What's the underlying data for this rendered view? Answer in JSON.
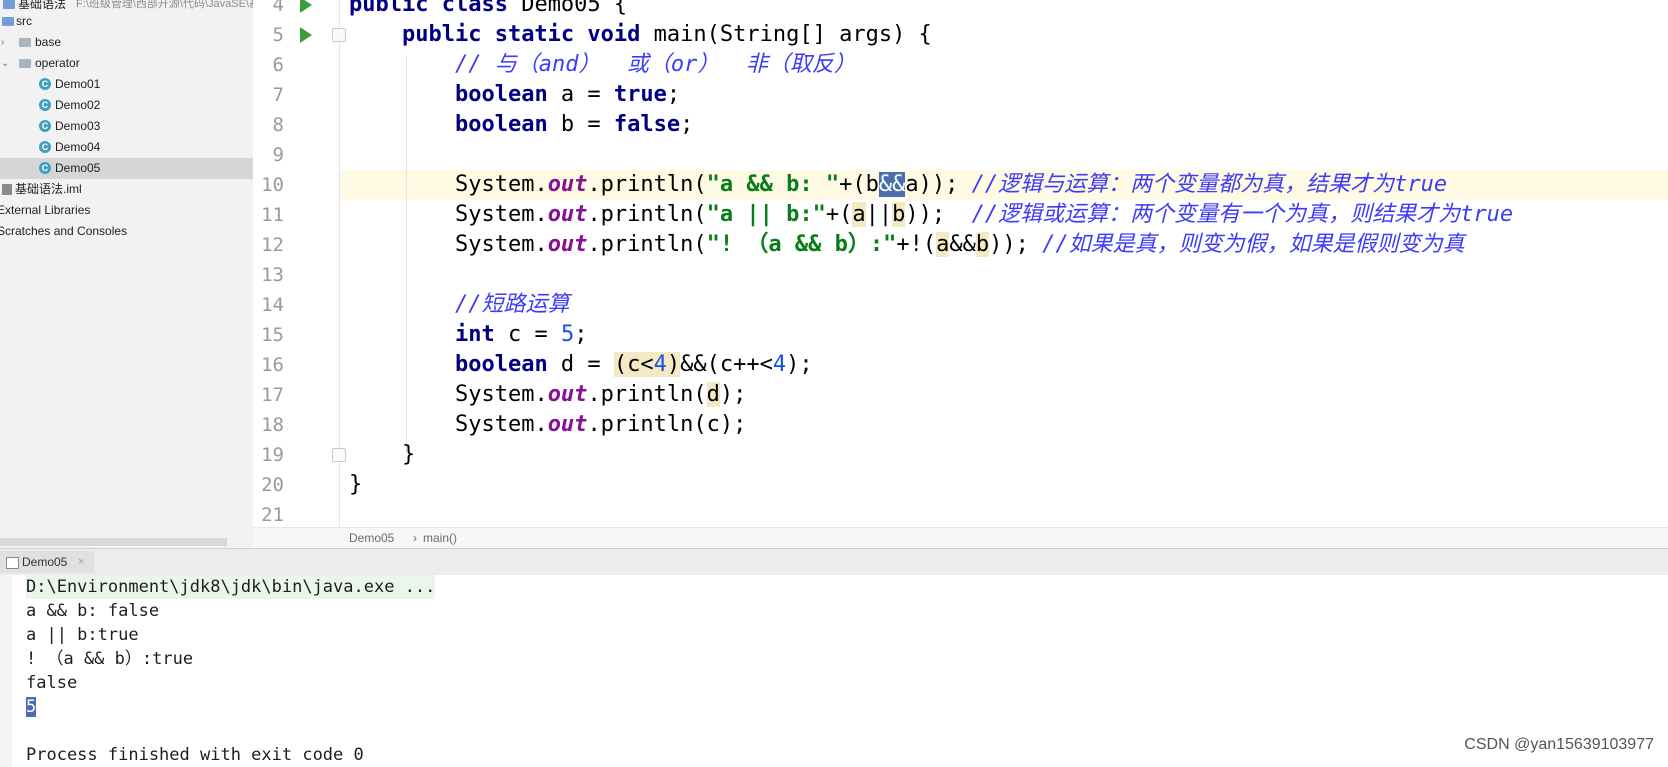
{
  "tree": {
    "project_label": "基础语法",
    "project_path": "F:\\班级管理\\西部开源\\代码\\JavaSE\\基础",
    "items": [
      {
        "label": "src",
        "icon": "folder-icon"
      },
      {
        "label": "base",
        "icon": "package-icon"
      },
      {
        "label": "operator",
        "icon": "package-icon"
      },
      {
        "label": "Demo01",
        "icon": "class-icon"
      },
      {
        "label": "Demo02",
        "icon": "class-icon"
      },
      {
        "label": "Demo03",
        "icon": "class-icon"
      },
      {
        "label": "Demo04",
        "icon": "class-icon"
      },
      {
        "label": "Demo05",
        "icon": "class-icon"
      },
      {
        "label": "基础语法.iml",
        "icon": "iml-file-icon"
      },
      {
        "label": "External Libraries",
        "icon": "library-icon"
      },
      {
        "label": "Scratches and Consoles",
        "icon": "scratches-icon"
      }
    ]
  },
  "editor": {
    "line_numbers": [
      "4",
      "5",
      "6",
      "7",
      "8",
      "9",
      "10",
      "11",
      "12",
      "13",
      "14",
      "15",
      "16",
      "17",
      "18",
      "19",
      "20",
      "21"
    ],
    "code": {
      "l4_kw": "public class",
      "l4_rest": " Demo05 {",
      "l5_kw": "public static void",
      "l5_rest": " main(String[] args) {",
      "l6_cmt": "// 与（and）  或（or）  非（取反）",
      "l7_kw": "boolean",
      "l7_a": " a = ",
      "l7_val": "true",
      "l7_end": ";",
      "l8_kw": "boolean",
      "l8_a": " b = ",
      "l8_val": "false",
      "l8_end": ";",
      "l10_sys": "System.",
      "l10_out": "out",
      "l10_p": ".println(",
      "l10_str": "\"a && b: \"",
      "l10_b1": "+(b",
      "l10_sel": "&&",
      "l10_b2": "a)); ",
      "l10_cmt": "//逻辑与运算：两个变量都为真，结果才为true",
      "l11_sys": "System.",
      "l11_out": "out",
      "l11_p": ".println(",
      "l11_str": "\"a || b:\"",
      "l11_a": "+(",
      "l11_h1": "a",
      "l11_mid": "||",
      "l11_h2": "b",
      "l11_end": "));  ",
      "l11_cmt": "//逻辑或运算：两个变量有一个为真，则结果才为true",
      "l12_sys": "System.",
      "l12_out": "out",
      "l12_p": ".println(",
      "l12_str": "\"! （a && b）:\"",
      "l12_a": "+!(",
      "l12_h1": "a",
      "l12_mid": "&&",
      "l12_h2": "b",
      "l12_end": ")); ",
      "l12_cmt": "//如果是真，则变为假，如果是假则变为真",
      "l14_cmt": "//短路运算",
      "l15_kw": "int",
      "l15_a": " c = ",
      "l15_num": "5",
      "l15_end": ";",
      "l16_kw": "boolean",
      "l16_a": " d = ",
      "l16_h1": "(c<",
      "l16_n1": "4",
      "l16_h2": ")",
      "l16_mid": "&&(c++<",
      "l16_n2": "4",
      "l16_end": ");",
      "l17_sys": "System.",
      "l17_out": "out",
      "l17_p": ".println(",
      "l17_d": "d",
      "l17_end": ");",
      "l18_sys": "System.",
      "l18_out": "out",
      "l18_p": ".println(c);",
      "l19": "}",
      "l20": "}"
    }
  },
  "breadcrumb": {
    "class": "Demo05",
    "sep": "›",
    "method": "main()"
  },
  "run_panel": {
    "tab_label": "Demo05",
    "close_glyph": "×",
    "output": [
      "D:\\Environment\\jdk8\\jdk\\bin\\java.exe ...",
      "a && b: false",
      "a || b:true",
      "! （a && b）:true",
      "false",
      "5",
      "",
      "Process finished with exit code 0"
    ]
  },
  "watermark": "CSDN @yan15639103977",
  "colors": {
    "keyword": "#000080",
    "string": "#067d17",
    "number": "#1750eb",
    "static_field": "#871094",
    "comment": "#3d3df5",
    "selection": "#4b6eaf",
    "caret_line": "#fffae3",
    "run_icon": "#3d9c3d"
  }
}
